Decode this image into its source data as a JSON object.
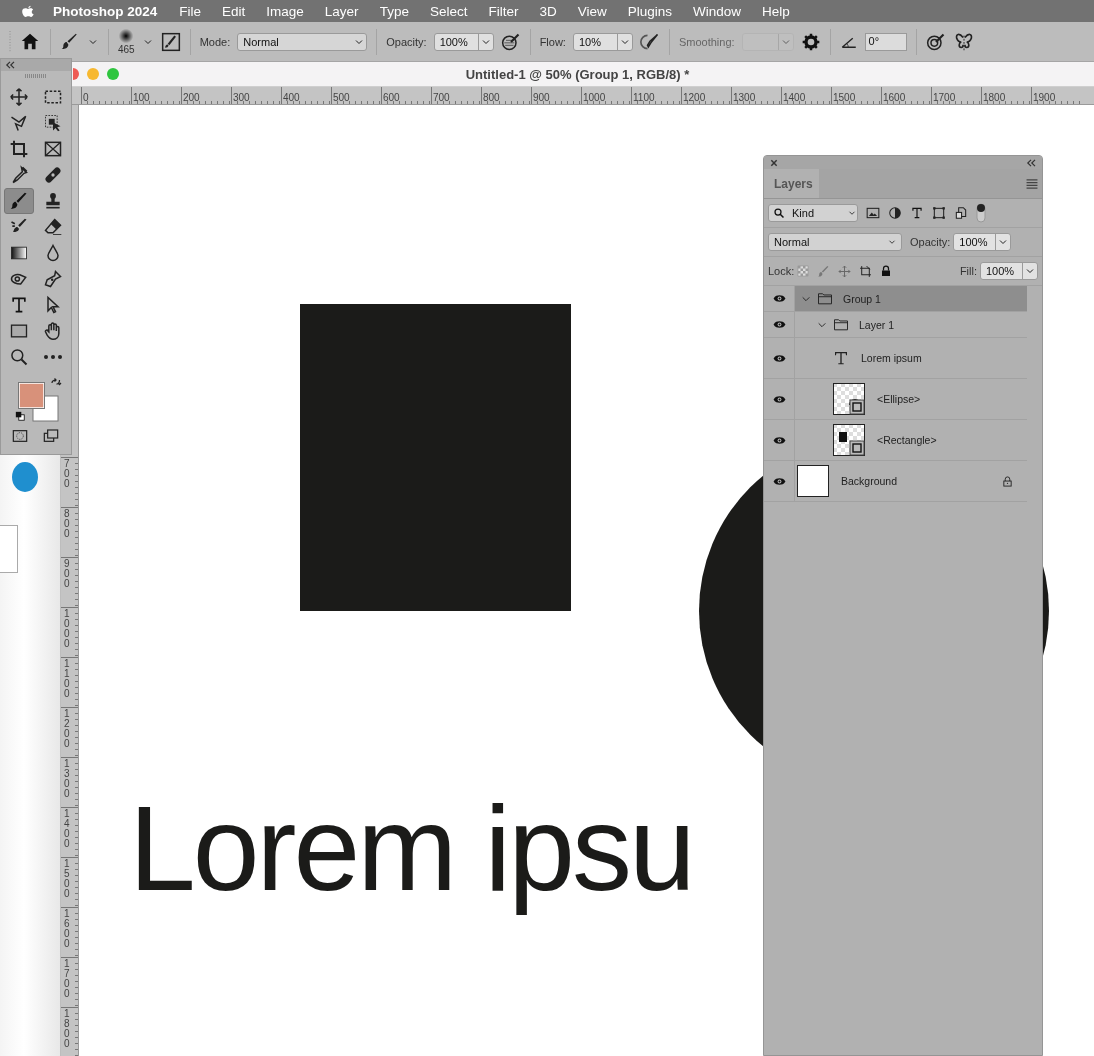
{
  "menu_bar": {
    "app_name": "Photoshop 2024",
    "items": [
      "File",
      "Edit",
      "Image",
      "Layer",
      "Type",
      "Select",
      "Filter",
      "3D",
      "View",
      "Plugins",
      "Window",
      "Help"
    ]
  },
  "options_bar": {
    "brush_size": "465",
    "mode": {
      "label": "Mode:",
      "value": "Normal"
    },
    "opacity": {
      "label": "Opacity:",
      "value": "100%"
    },
    "flow": {
      "label": "Flow:",
      "value": "10%"
    },
    "smoothing": {
      "label": "Smoothing:",
      "disabled": true
    },
    "angle": {
      "value": "0°"
    }
  },
  "toolbox": {
    "tools": [
      {
        "selected": false
      },
      {
        "selected": false
      },
      {
        "selected": false
      },
      {
        "selected": false
      },
      {
        "selected": false
      },
      {
        "selected": false
      },
      {
        "selected": false
      },
      {
        "selected": false
      },
      {
        "selected": true
      },
      {
        "selected": false
      },
      {
        "selected": false
      },
      {
        "selected": false
      },
      {
        "selected": false
      },
      {
        "selected": false
      },
      {
        "selected": false
      },
      {
        "selected": false
      },
      {
        "selected": false
      },
      {
        "selected": false
      },
      {
        "selected": false
      },
      {
        "selected": false
      },
      {
        "selected": false
      },
      {
        "selected": false
      }
    ]
  },
  "document": {
    "title": "Untitled-1 @ 50% (Group 1, RGB/8) *",
    "ruler_h": [
      "0",
      "100",
      "200",
      "300",
      "400",
      "500",
      "600",
      "700",
      "800",
      "900",
      "1000",
      "1100",
      "1200",
      "1300",
      "1400",
      "1500",
      "1600",
      "1700",
      "1800",
      "1900"
    ],
    "ruler_v": [
      "700",
      "800",
      "900",
      "1000",
      "1100",
      "1200",
      "1300",
      "1400",
      "1500",
      "1600",
      "1700",
      "1800"
    ],
    "canvas": {
      "text": "Lorem ipsu"
    }
  },
  "layers_panel": {
    "tab": "Layers",
    "filter": "Kind",
    "blend_mode": "Normal",
    "opacity_label": "Opacity:",
    "opacity": "100%",
    "lock_label": "Lock:",
    "fill_label": "Fill:",
    "fill": "100%",
    "layers": [
      {
        "name": "Group 1",
        "kind": "group",
        "visible": true,
        "selected": true,
        "locked": false,
        "expanded": true,
        "children": [
          {
            "name": "Layer 1",
            "kind": "group",
            "visible": true,
            "selected": false,
            "locked": false,
            "expanded": true,
            "children": [
              {
                "name": "Lorem ipsum",
                "kind": "text",
                "visible": true,
                "selected": false,
                "locked": false
              },
              {
                "name": "<Ellipse>",
                "kind": "ellipse",
                "visible": true,
                "selected": false,
                "locked": false
              },
              {
                "name": "<Rectangle>",
                "kind": "rectangle",
                "visible": true,
                "selected": false,
                "locked": false
              }
            ]
          }
        ]
      },
      {
        "name": "Background",
        "kind": "fill",
        "visible": true,
        "selected": false,
        "locked": true
      }
    ]
  }
}
